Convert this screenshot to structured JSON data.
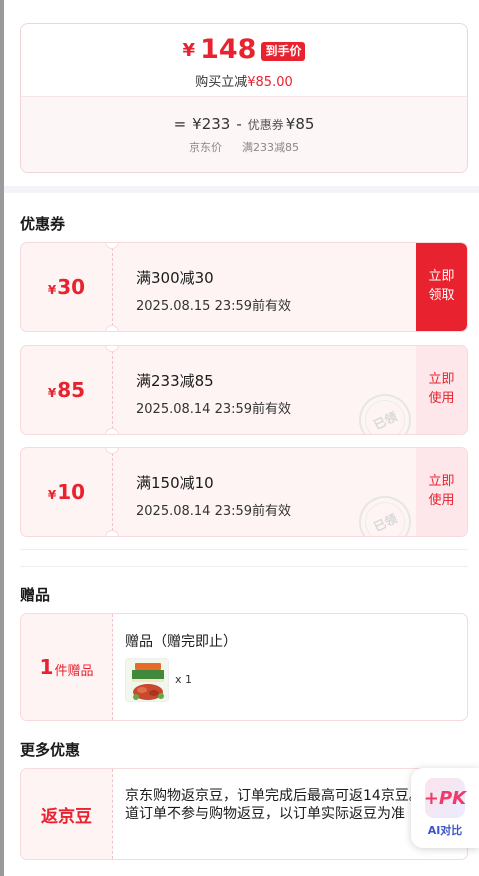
{
  "summary": {
    "currency": "¥",
    "final_price": "148",
    "final_tag": "到手价",
    "buy_discount_label": "购买立减",
    "buy_discount_value": "¥85.00",
    "equation_prefix": "=",
    "jd_price": "¥233",
    "minus": "-",
    "coupon_label": "优惠券",
    "coupon_value": "¥85",
    "jd_price_caption": "京东价",
    "coupon_caption": "满233减85"
  },
  "coupons_section": {
    "title": "优惠券",
    "items": [
      {
        "currency": "¥",
        "amount": "30",
        "condition": "满300减30",
        "expire": "2025.08.15 23:59前有效",
        "action_line1": "立即",
        "action_line2": "领取",
        "state": "claim"
      },
      {
        "currency": "¥",
        "amount": "85",
        "condition": "满233减85",
        "expire": "2025.08.14 23:59前有效",
        "action_line1": "立即",
        "action_line2": "使用",
        "state": "use",
        "stamp": "已领"
      },
      {
        "currency": "¥",
        "amount": "10",
        "condition": "满150减10",
        "expire": "2025.08.14 23:59前有效",
        "action_line1": "立即",
        "action_line2": "使用",
        "state": "use",
        "stamp": "已领"
      }
    ]
  },
  "gift_section": {
    "title": "赠品",
    "count": "1",
    "unit": "件赠品",
    "gift_title": "赠品（赠完即止）",
    "quantity": "x 1"
  },
  "more_section": {
    "title": "更多优惠",
    "bean_label": "返京豆",
    "bean_text": "京东购物返京豆，订单完成后最高可返14京豆。特殊渠道订单不参与购物返豆，以订单实际返豆为准"
  },
  "ai_compare": {
    "icon_text": "+PK",
    "label": "AI对比"
  },
  "colors": {
    "accent": "#e8232f",
    "coupon_bg": "#fef4f4",
    "use_bg": "#fde7ea"
  }
}
